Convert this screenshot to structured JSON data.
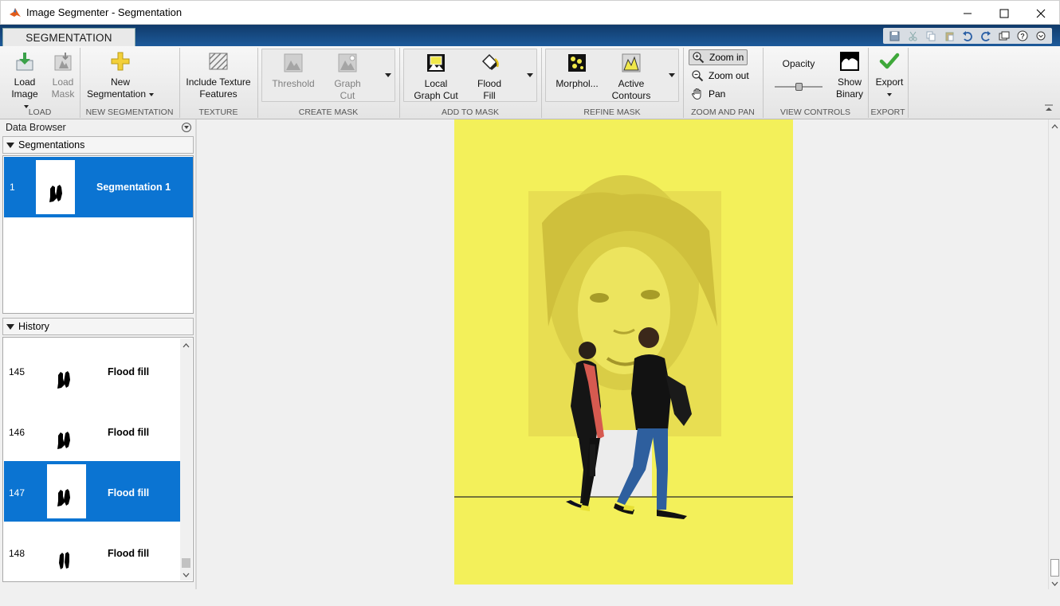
{
  "window": {
    "title": "Image Segmenter - Segmentation",
    "minimize_icon": "minimize-icon",
    "maximize_icon": "maximize-icon",
    "close_icon": "close-icon"
  },
  "ribbon": {
    "tab": "SEGMENTATION",
    "groups": {
      "load": "LOAD",
      "new_segmentation": "NEW SEGMENTATION",
      "texture": "TEXTURE",
      "create_mask": "CREATE MASK",
      "add_to_mask": "ADD TO MASK",
      "refine_mask": "REFINE MASK",
      "zoom_and_pan": "ZOOM AND PAN",
      "view_controls": "VIEW CONTROLS",
      "export": "EXPORT"
    },
    "buttons": {
      "load_image_1": "Load",
      "load_image_2": "Image",
      "load_mask_1": "Load",
      "load_mask_2": "Mask",
      "new_seg_1": "New",
      "new_seg_2": "Segmentation",
      "texture_1": "Include Texture",
      "texture_2": "Features",
      "threshold": "Threshold",
      "graph_cut_1": "Graph",
      "graph_cut_2": "Cut",
      "local_graph_cut_1": "Local",
      "local_graph_cut_2": "Graph Cut",
      "flood_fill_1": "Flood",
      "flood_fill_2": "Fill",
      "morphology": "Morphol...",
      "active_contours_1": "Active",
      "active_contours_2": "Contours",
      "zoom_in": "Zoom in",
      "zoom_out": "Zoom out",
      "pan": "Pan",
      "opacity": "Opacity",
      "show_binary_1": "Show",
      "show_binary_2": "Binary",
      "export": "Export"
    },
    "opacity_value": 0.5
  },
  "data_browser": {
    "title": "Data Browser",
    "segmentations_header": "Segmentations",
    "segmentations": [
      {
        "index": "1",
        "label": "Segmentation 1",
        "selected": true
      }
    ],
    "history_header": "History",
    "history": [
      {
        "index": "145",
        "label": "Flood fill",
        "selected": false
      },
      {
        "index": "146",
        "label": "Flood fill",
        "selected": false
      },
      {
        "index": "147",
        "label": "Flood fill",
        "selected": true
      },
      {
        "index": "148",
        "label": "Flood fill",
        "selected": false
      }
    ]
  },
  "colors": {
    "selection": "#0b74d2",
    "overlay": "#f3f05a",
    "ribbon_tab_bar": "#1d5a9a"
  }
}
